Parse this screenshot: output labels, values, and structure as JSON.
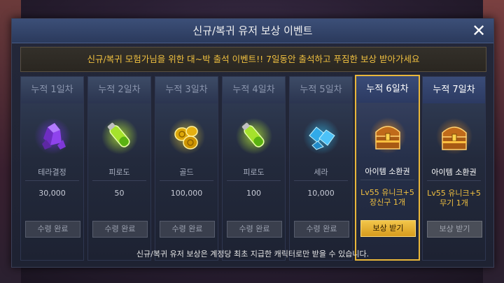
{
  "modal": {
    "title": "신규/복귀 유저 보상 이벤트",
    "close_label": "✕",
    "banner": "신규/복귀 모험가님을 위한 대~박 출석 이벤트!! 7일동안 출석하고 푸짐한 보상 받아가세요",
    "footer": "신규/복귀 유저 보상은 계정당 최초 지급한 캐릭터로만 받을 수 있습니다."
  },
  "days": [
    {
      "label": "누적 1일차",
      "item": "테라결정",
      "amount": "30,000",
      "button": "수령 완료",
      "state": "claimed",
      "icon": "crystal-icon"
    },
    {
      "label": "누적 2일차",
      "item": "피로도",
      "amount": "50",
      "button": "수령 완료",
      "state": "claimed",
      "icon": "potion-icon"
    },
    {
      "label": "누적 3일차",
      "item": "골드",
      "amount": "100,000",
      "button": "수령 완료",
      "state": "claimed",
      "icon": "gold-coins-icon"
    },
    {
      "label": "누적 4일차",
      "item": "피로도",
      "amount": "100",
      "button": "수령 완료",
      "state": "claimed",
      "icon": "potion-icon"
    },
    {
      "label": "누적 5일차",
      "item": "세라",
      "amount": "10,000",
      "button": "수령 완료",
      "state": "claimed",
      "icon": "sera-gem-icon"
    },
    {
      "label": "누적 6일차",
      "item": "아이템 소환권",
      "amount": "Lv55 유니크+5\n장신구 1개",
      "button": "보상 받기",
      "state": "available",
      "icon": "treasure-chest-icon"
    },
    {
      "label": "누적 7일차",
      "item": "아이템 소환권",
      "amount": "Lv55 유니크+5\n무기 1개",
      "button": "보상 받기",
      "state": "locked",
      "icon": "treasure-chest-icon"
    }
  ],
  "colors": {
    "accent_gold": "#f0c040",
    "active_border": "#e9b73a",
    "titlebar": "#3c4f78"
  }
}
